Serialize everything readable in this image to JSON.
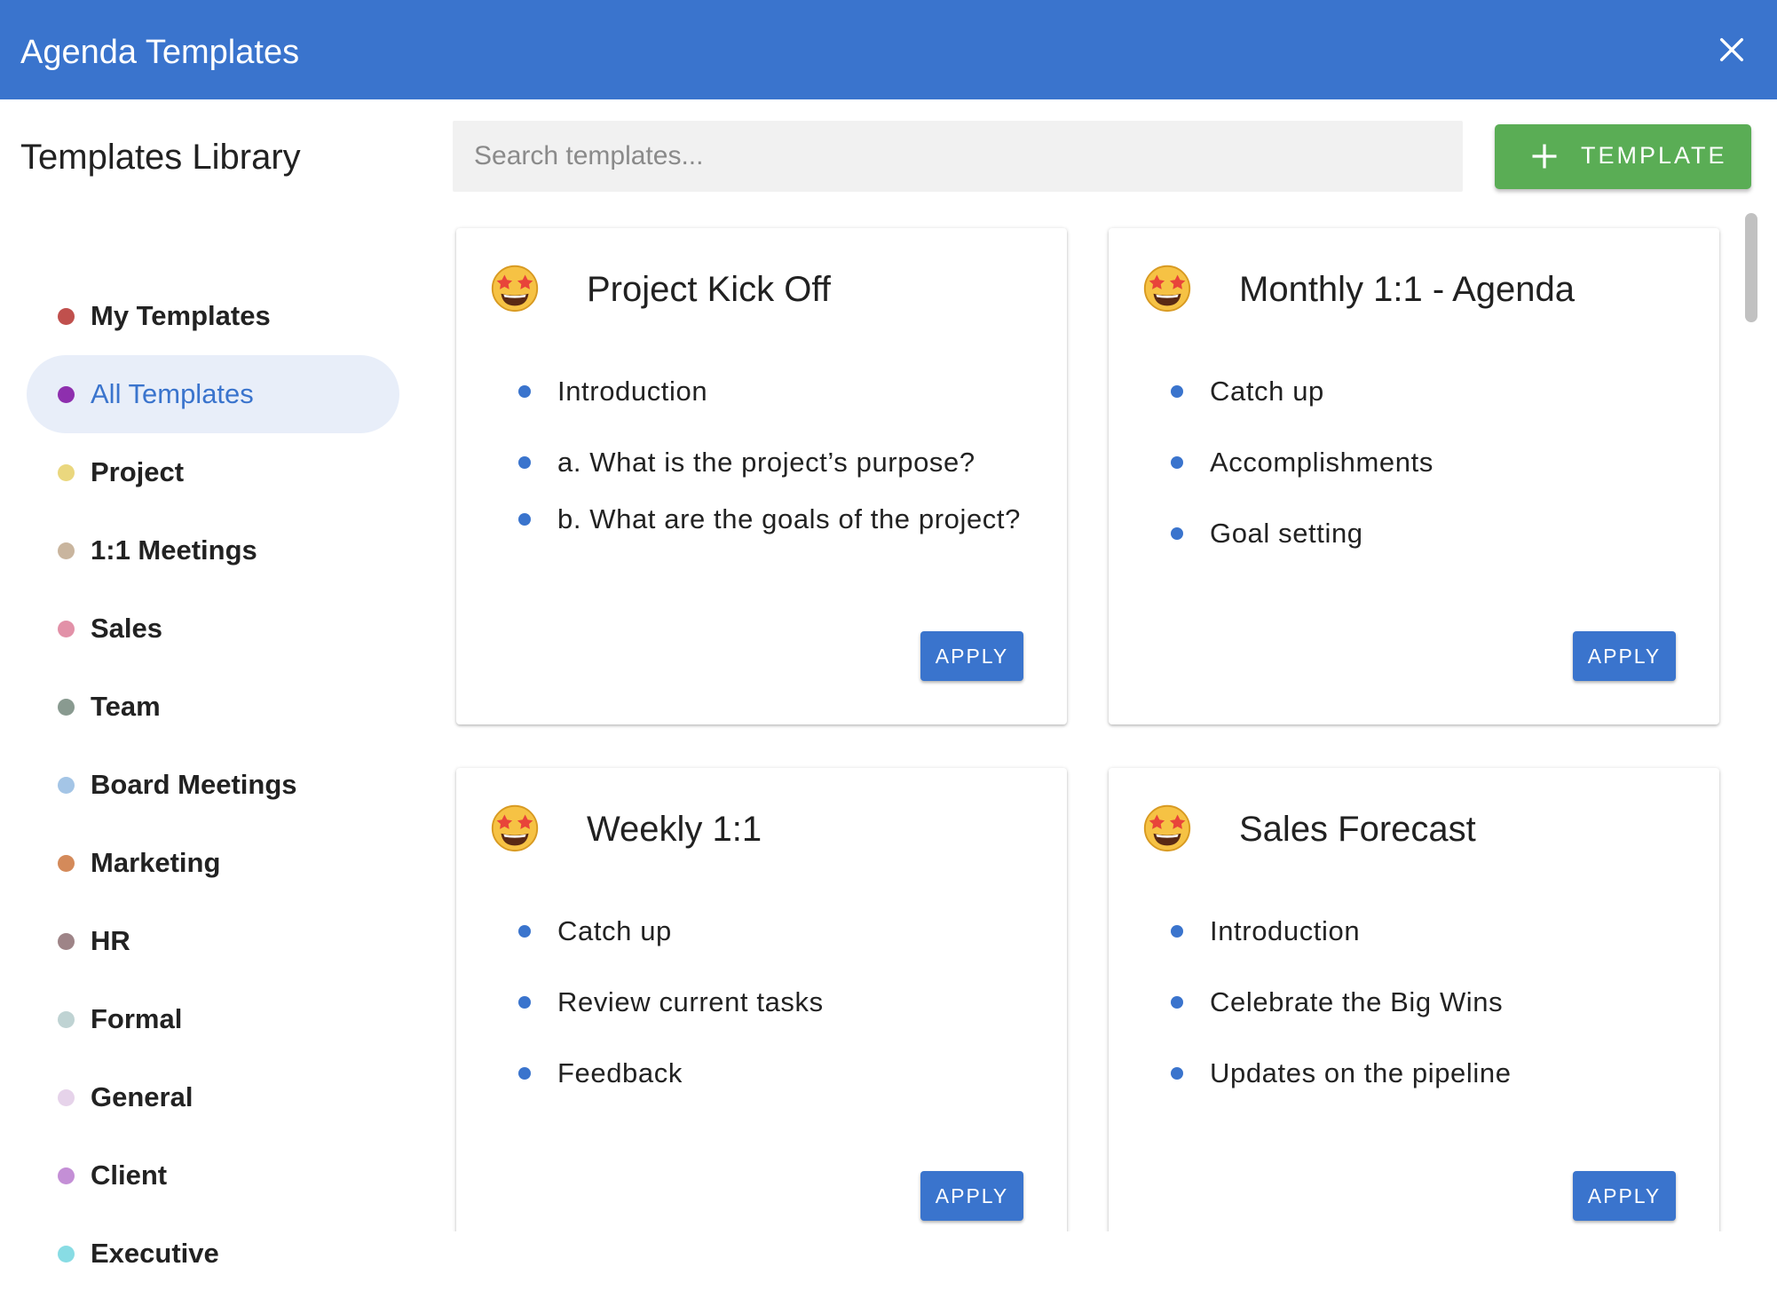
{
  "header": {
    "title": "Agenda Templates"
  },
  "sidebar": {
    "title": "Templates Library",
    "categories": [
      {
        "label": "My Templates",
        "color": "#c0504d"
      },
      {
        "label": "All Templates",
        "color": "#8e2fae",
        "active": true
      },
      {
        "label": "Project",
        "color": "#ead77e"
      },
      {
        "label": "1:1 Meetings",
        "color": "#c9b59e"
      },
      {
        "label": "Sales",
        "color": "#e291a8"
      },
      {
        "label": "Team",
        "color": "#899a90"
      },
      {
        "label": "Board Meetings",
        "color": "#a4c5e6"
      },
      {
        "label": "Marketing",
        "color": "#d48a5a"
      },
      {
        "label": "HR",
        "color": "#9e8487"
      },
      {
        "label": "Formal",
        "color": "#bfd3d3"
      },
      {
        "label": "General",
        "color": "#e6d3ea"
      },
      {
        "label": "Client",
        "color": "#c48fd6"
      },
      {
        "label": "Executive",
        "color": "#88dce4"
      }
    ]
  },
  "search": {
    "placeholder": "Search templates..."
  },
  "add_button": {
    "label": "TEMPLATE"
  },
  "cards": [
    {
      "title": "Project Kick Off",
      "items": [
        "Introduction",
        "a. What is the project’s purpose?",
        "b. What are the goals of the project?"
      ],
      "apply_label": "APPLY"
    },
    {
      "title": "Monthly 1:1 - Agenda",
      "items": [
        "Catch up",
        "Accomplishments",
        "Goal setting"
      ],
      "apply_label": "APPLY"
    },
    {
      "title": "Weekly 1:1",
      "items": [
        "Catch up",
        "Review current tasks",
        "Feedback"
      ],
      "apply_label": "APPLY"
    },
    {
      "title": "Sales Forecast",
      "items": [
        "Introduction",
        "Celebrate the Big Wins",
        "Updates on the pipeline"
      ],
      "apply_label": "APPLY"
    }
  ],
  "colors": {
    "primary": "#3a74cd",
    "accent_green": "#5aad55"
  }
}
